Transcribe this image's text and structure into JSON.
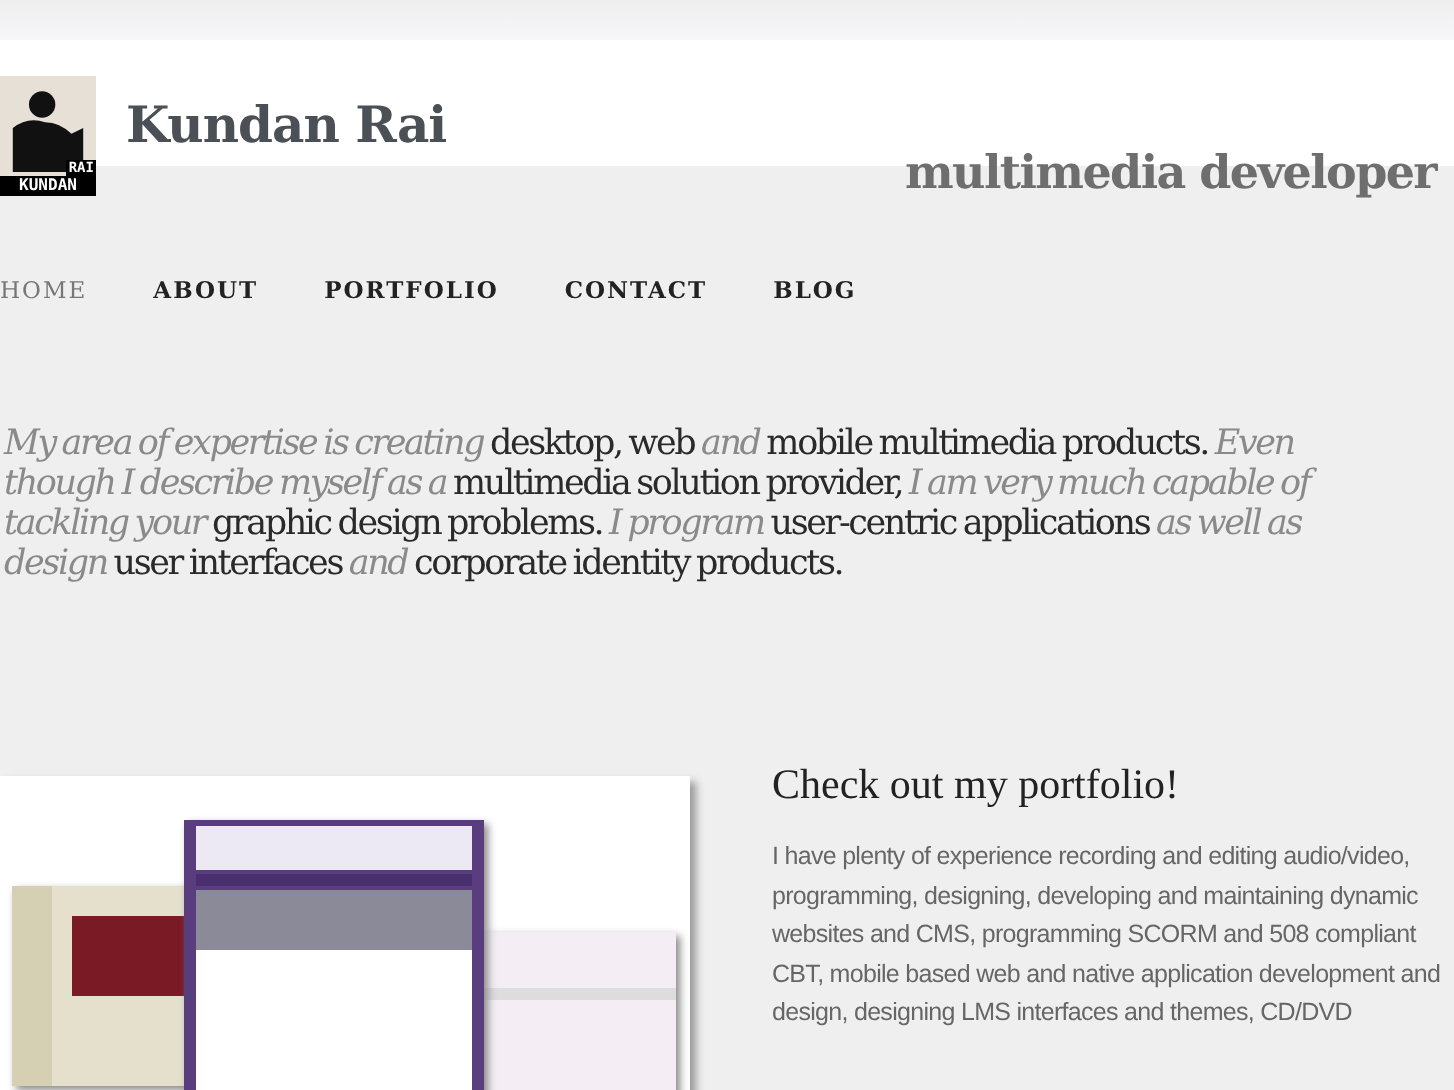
{
  "header": {
    "name": "Kundan Rai",
    "tagline": "multimedia developer",
    "logo_text": [
      "KUNDAN",
      "RAI"
    ]
  },
  "nav": [
    {
      "label": "HOME",
      "selected": true
    },
    {
      "label": "ABOUT",
      "selected": false
    },
    {
      "label": "PORTFOLIO",
      "selected": false
    },
    {
      "label": "CONTACT",
      "selected": false
    },
    {
      "label": "BLOG",
      "selected": false
    }
  ],
  "intro": "My area of expertise is creating **desktop, web** and **mobile multimedia products.** Even though I describe myself as a **multimedia solution provider,** I am very much capable of tackling your **graphic design problems.** I program **user-centric applications** as well as design **user interfaces** and **corporate identity products.**",
  "portfolio": {
    "heading": "Check out my portfolio!",
    "text": "I have plenty of experience recording and editing audio/video, programming, designing, developing and maintaining dynamic websites and CMS, programming SCORM and 508 compliant CBT, mobile based web and native application development and design, designing LMS interfaces and themes, CD/DVD"
  }
}
